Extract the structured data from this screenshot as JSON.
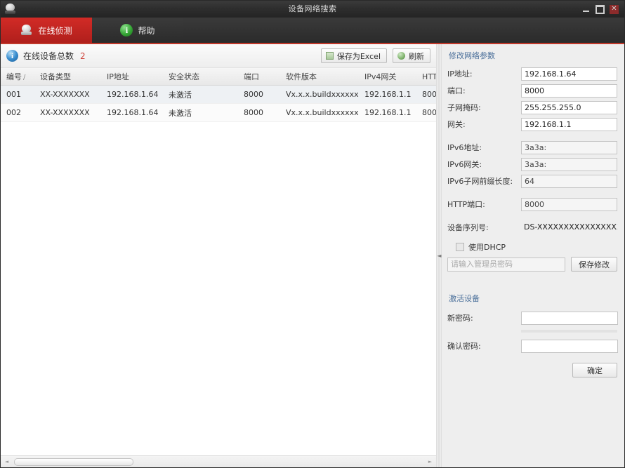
{
  "window": {
    "title": "设备网络搜索",
    "logo_icon": "camera-dome-icon",
    "controls": {
      "minimize": "minimize-icon",
      "maximize": "maximize-icon",
      "close": "✕"
    }
  },
  "tabs": [
    {
      "label": "在线侦测",
      "icon": "camera-dome-icon",
      "active": true
    },
    {
      "label": "帮助",
      "icon": "help-circle-icon",
      "active": false
    }
  ],
  "toolbar": {
    "info_icon": "info-circle-icon",
    "total_label": "在线设备总数",
    "total_count": "2",
    "save_excel_label": "保存为Excel",
    "save_excel_icon": "excel-sheet-icon",
    "refresh_label": "刷新",
    "refresh_icon": "refresh-icon"
  },
  "table": {
    "columns": [
      {
        "label": "编号",
        "sort": "/"
      },
      {
        "label": "设备类型",
        "sort": ""
      },
      {
        "label": "IP地址",
        "sort": ""
      },
      {
        "label": "安全状态",
        "sort": ""
      },
      {
        "label": "端口",
        "sort": ""
      },
      {
        "label": "软件版本",
        "sort": ""
      },
      {
        "label": "IPv4网关",
        "sort": ""
      },
      {
        "label": "HTT",
        "sort": ""
      }
    ],
    "rows": [
      {
        "id": "001",
        "device_type": "XX-XXXXXXX",
        "ip": "192.168.1.64",
        "security": "未激活",
        "port": "8000",
        "version": "Vx.x.x.buildxxxxxx",
        "gateway": "192.168.1.1",
        "http_port": "800"
      },
      {
        "id": "002",
        "device_type": "XX-XXXXXXX",
        "ip": "192.168.1.64",
        "security": "未激活",
        "port": "8000",
        "version": "Vx.x.x.buildxxxxxx",
        "gateway": "192.168.1.1",
        "http_port": "800"
      }
    ]
  },
  "scrollbar": {
    "left_arrow": "◄",
    "right_arrow": "►"
  },
  "divider": {
    "handle_icon": "collapse-arrow-icon",
    "glyph": "◄"
  },
  "network_panel": {
    "title": "修改网络参数",
    "fields": [
      {
        "label": "IP地址:",
        "value": "192.168.1.64"
      },
      {
        "label": "端口:",
        "value": "8000"
      },
      {
        "label": "子网掩码:",
        "value": "255.255.255.0"
      },
      {
        "label": "网关:",
        "value": "192.168.1.1"
      },
      {
        "label": "IPv6地址:",
        "value": "3a3a:"
      },
      {
        "label": "IPv6网关:",
        "value": "3a3a:"
      },
      {
        "label": "IPv6子网前缀长度:",
        "value": "64"
      },
      {
        "label": "HTTP端口:",
        "value": "8000"
      },
      {
        "label": "设备序列号:",
        "value": "DS-XXXXXXXXXXXXXXXX"
      }
    ],
    "dhcp_label": "使用DHCP",
    "dhcp_checked": false,
    "password_placeholder": "请输入管理员密码",
    "save_button": "保存修改"
  },
  "activate_panel": {
    "title": "激活设备",
    "new_password_label": "新密码:",
    "new_password_value": "",
    "confirm_password_label": "确认密码:",
    "confirm_password_value": "",
    "ok_button": "确定"
  }
}
